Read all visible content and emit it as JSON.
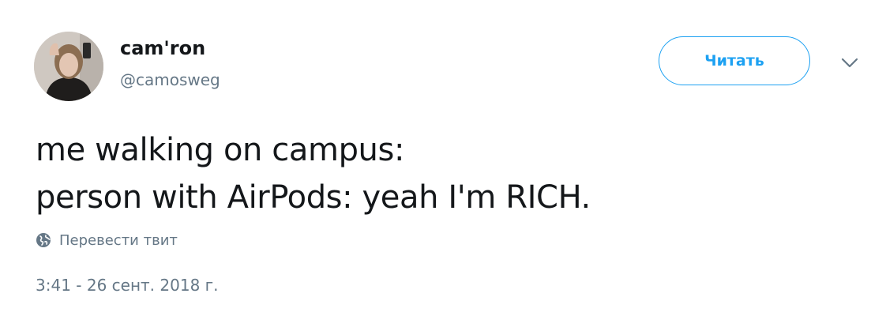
{
  "author": {
    "display_name": "cam'ron",
    "handle": "@camosweg",
    "avatar_icon": "user-photo"
  },
  "header": {
    "follow_label": "Читать",
    "menu_icon": "chevron-down-icon"
  },
  "tweet": {
    "lines": [
      "me walking on campus:",
      "person with AirPods: yeah I'm RICH."
    ],
    "translate_label": "Перевести твит",
    "translate_icon": "globe-icon",
    "timestamp": "3:41 - 26 сент. 2018 г."
  },
  "colors": {
    "accent": "#1da1f2",
    "text_primary": "#14171a",
    "text_secondary": "#657786"
  }
}
